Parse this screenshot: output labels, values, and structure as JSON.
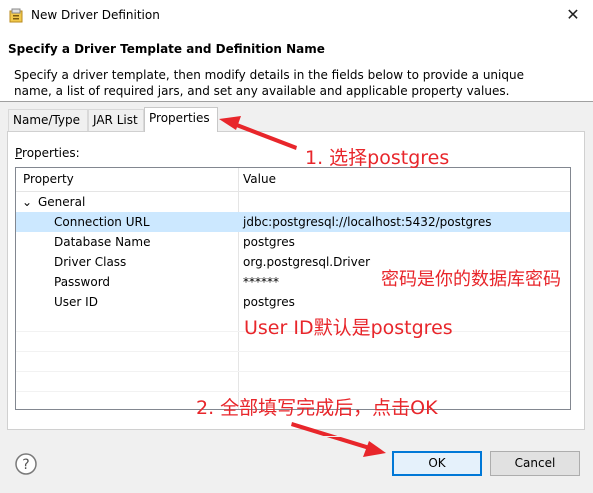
{
  "window": {
    "title": "New Driver Definition",
    "close_glyph": "✕"
  },
  "header": {
    "title": "Specify a Driver Template and Definition Name",
    "description": "Specify a driver template, then modify details in the fields below to provide a unique name, a list of required jars, and set any available and applicable property values."
  },
  "tabs": [
    {
      "label": "Name/Type",
      "active": false
    },
    {
      "label": "JAR List",
      "active": false
    },
    {
      "label": "Properties",
      "active": true
    }
  ],
  "properties_panel": {
    "label_mnemonic": "P",
    "label_rest": "roperties:",
    "columns": [
      "Property",
      "Value"
    ],
    "group": {
      "chevron": "⌄",
      "label": "General"
    },
    "rows": [
      {
        "property": "Connection URL",
        "value": "jdbc:postgresql://localhost:5432/postgres",
        "selected": true
      },
      {
        "property": "Database Name",
        "value": "postgres",
        "selected": false
      },
      {
        "property": "Driver Class",
        "value": "org.postgresql.Driver",
        "selected": false
      },
      {
        "property": "Password",
        "value": "******",
        "selected": false
      },
      {
        "property": "User ID",
        "value": "postgres",
        "selected": false
      }
    ]
  },
  "annotations": {
    "step1": "1. 选择postgres",
    "password_note": "密码是你的数据库密码",
    "userid_note": "User ID默认是postgres",
    "step2": "2. 全部填写完成后，点击OK",
    "color": "#e8262b"
  },
  "buttons": {
    "help_icon": "?",
    "ok_label": "OK",
    "cancel_label": "Cancel"
  }
}
